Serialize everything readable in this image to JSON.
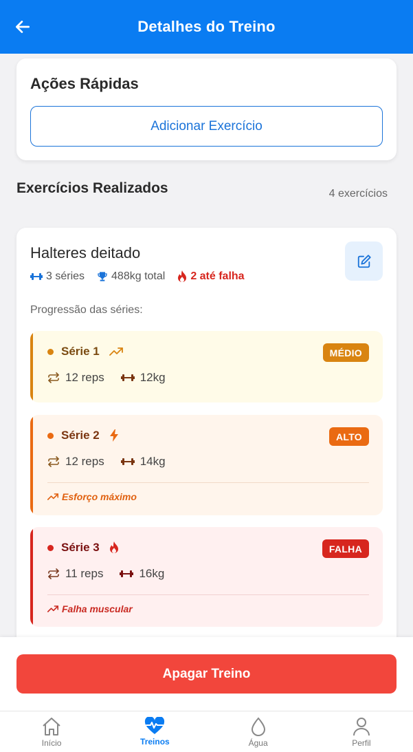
{
  "header": {
    "title": "Detalhes do Treino",
    "back_icon": "arrow-left-icon"
  },
  "quick_actions": {
    "title": "Ações Rápidas",
    "add_button": "Adicionar Exercício"
  },
  "section": {
    "title": "Exercícios Realizados",
    "count": "4 exercícios"
  },
  "exercise": {
    "name": "Halteres deitado",
    "sets": "3 séries",
    "total": "488kg total",
    "failure": "2 até falha",
    "progression_label": "Progressão das séries:",
    "series": [
      {
        "name": "Série 1",
        "badge": "MÉDIO",
        "reps": "12 reps",
        "weight": "12kg",
        "icon": "trending-up-icon",
        "note": ""
      },
      {
        "name": "Série 2",
        "badge": "ALTO",
        "reps": "12 reps",
        "weight": "14kg",
        "icon": "lightning-icon",
        "note": "Esforço máximo"
      },
      {
        "name": "Série 3",
        "badge": "FALHA",
        "reps": "11 reps",
        "weight": "16kg",
        "icon": "flame-icon",
        "note": "Falha muscular"
      }
    ]
  },
  "delete_button": "Apagar Treino",
  "tabs": [
    {
      "label": "Início",
      "icon": "home-icon",
      "active": false
    },
    {
      "label": "Treinos",
      "icon": "heart-pulse-icon",
      "active": true
    },
    {
      "label": "Água",
      "icon": "water-drop-icon",
      "active": false
    },
    {
      "label": "Perfil",
      "icon": "person-icon",
      "active": false
    }
  ],
  "colors": {
    "primary": "#0a7cf2",
    "medium": "#d98411",
    "high": "#ea6a12",
    "failure": "#d7261e",
    "danger_button": "#f2463c"
  }
}
